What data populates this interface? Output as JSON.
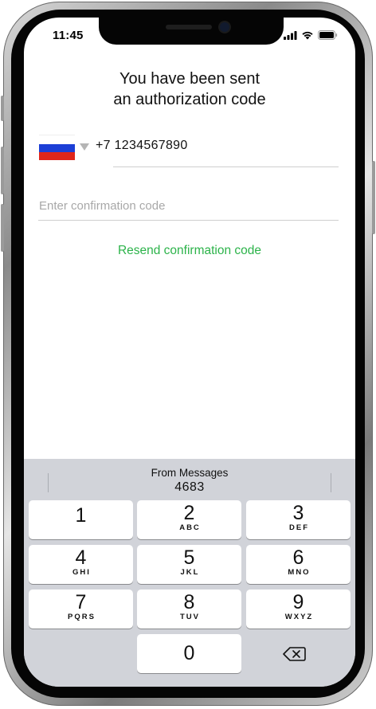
{
  "status_bar": {
    "time": "11:45",
    "icons": [
      "signal-icon",
      "wifi-icon",
      "battery-icon"
    ]
  },
  "auth": {
    "title_line1": "You have been sent",
    "title_line2": "an authorization code",
    "country_flag": "russia-flag",
    "phone_number": "+7 1234567890",
    "code_placeholder": "Enter confirmation code",
    "code_value": "",
    "resend_label": "Resend confirmation code"
  },
  "keyboard": {
    "suggestion_label": "From Messages",
    "suggestion_code": "4683",
    "keys": [
      {
        "digit": "1",
        "letters": ""
      },
      {
        "digit": "2",
        "letters": "ABC"
      },
      {
        "digit": "3",
        "letters": "DEF"
      },
      {
        "digit": "4",
        "letters": "GHI"
      },
      {
        "digit": "5",
        "letters": "JKL"
      },
      {
        "digit": "6",
        "letters": "MNO"
      },
      {
        "digit": "7",
        "letters": "PQRS"
      },
      {
        "digit": "8",
        "letters": "TUV"
      },
      {
        "digit": "9",
        "letters": "WXYZ"
      },
      {
        "digit": "0",
        "letters": ""
      }
    ]
  },
  "colors": {
    "accent_green": "#2cb34a",
    "keyboard_bg": "#d1d3d9",
    "flag_white": "#ffffff",
    "flag_blue": "#1c3fd6",
    "flag_red": "#e0261b"
  }
}
